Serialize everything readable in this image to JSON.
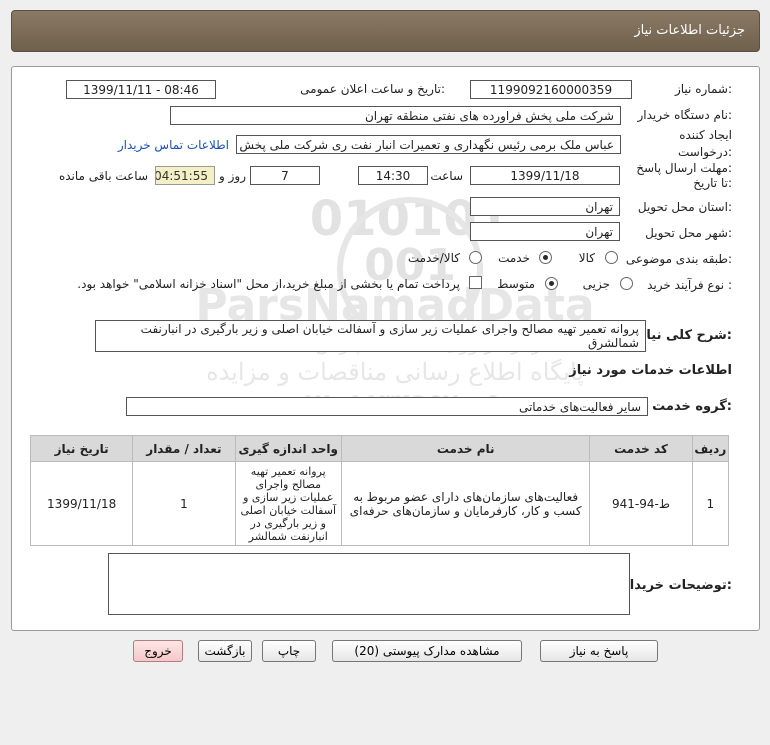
{
  "header": {
    "title": "جزئیات اطلاعات نیاز"
  },
  "form": {
    "need_number_label": "شماره نیاز:",
    "need_number": "1199092160000359",
    "announce_label": "تاریخ و ساعت اعلان عمومی:",
    "announce_value": "1399/11/11 - 08:46",
    "buyer_org_label": "نام دستگاه خریدار:",
    "buyer_org": "شرکت ملی پخش فراورده های نفتی منطقه تهران",
    "creator_label_1": "ایجاد کننده",
    "creator_label_2": "درخواست:",
    "creator": "عباس ملک برمی رئیس نگهداری و تعمیرات انبار نفت ری شرکت ملی پخش فراو",
    "contact_link": "اطلاعات تماس خریدار",
    "deadline_label_1": "مهلت ارسال پاسخ:",
    "deadline_label_2": "تا تاریخ:",
    "deadline_date": "1399/11/18",
    "time_label": "ساعت",
    "deadline_time": "14:30",
    "days_value": "7",
    "days_label": "روز و",
    "remaining_time": "04:51:55",
    "remaining_label": "ساعت باقی مانده",
    "province_label": "استان محل تحویل:",
    "province": "تهران",
    "city_label": "شهر محل تحویل:",
    "city": "تهران",
    "category_label": "طبقه بندی موضوعی:",
    "category_options": [
      "کالا",
      "خدمت",
      "کالا/خدمت"
    ],
    "category_selected": "خدمت",
    "process_label": "نوع فرآیند خرید :",
    "process_options": [
      "جزیی",
      "متوسط"
    ],
    "process_selected": "متوسط",
    "payment_note": "پرداخت تمام یا بخشی از مبلغ خرید،از محل \"اسناد خزانه اسلامی\" خواهد بود.",
    "summary_label": "شرح کلی نیاز:",
    "summary": "پروانه تعمیر تهیه مصالح واجرای عملیات زیر سازی و آسفالت خیابان اصلی و زیر بارگیری در انبارنفت شمالشرق",
    "services_heading": "اطلاعات خدمات مورد نیاز",
    "service_group_label": "گروه خدمت:",
    "service_group": "سایر فعالیت‌های خدماتی",
    "buyer_notes_label": "توضیحات خریدار:",
    "buyer_notes": ""
  },
  "table": {
    "headers": [
      "ردیف",
      "کد خدمت",
      "نام خدمت",
      "واحد اندازه گیری",
      "تعداد / مقدار",
      "تاریخ نیاز"
    ],
    "rows": [
      {
        "row": "1",
        "code": "ط-94-941",
        "name": "فعالیت‌های سازمان‌های دارای عضو مربوط به کسب و کار، کارفرمایان و سازمان‌های حرفه‌ای",
        "unit": "پروانه تعمیر تهیه مصالح واجرای عملیات زیر سازی و آسفالت خیابان اصلی و زیر بارگیری در انبارنفت شمالشر",
        "qty": "1",
        "date": "1399/11/18"
      }
    ]
  },
  "buttons": {
    "reply": "پاسخ به نیاز",
    "attachments": "مشاهده مدارک پیوستی (20)",
    "print": "چاپ",
    "back": "بازگشت",
    "exit": "خروج"
  },
  "watermark": {
    "digits_line1": "010101",
    "digits_line2": "001",
    "brand": "ParsNamadData",
    "org": "مرکز فراوری اطلاعات پارس نماد داده",
    "site": "پایگاه اطلاع رسانی مناقصات و مزایده",
    "phone": "۰۲۱-۸۸۳۴۹۶۷۰-۵"
  },
  "colors": {
    "titlebar": "#7d6e5a",
    "link": "#1b4fb3",
    "timer_bg": "#f4efc4",
    "exit_bg": "#f6c8c8"
  }
}
